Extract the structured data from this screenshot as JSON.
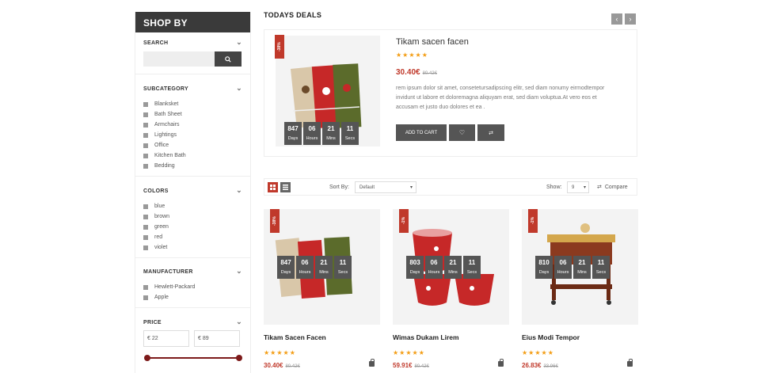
{
  "sidebar": {
    "title": "SHOP BY",
    "search": {
      "title": "SEARCH",
      "placeholder": ""
    },
    "subcategory": {
      "title": "SUBCATEGORY",
      "items": [
        "Blanksket",
        "Bath Sheet",
        "Armchairs",
        "Lightings",
        "Office",
        "Kitchen Bath",
        "Bedding"
      ]
    },
    "colors": {
      "title": "COLORS",
      "items": [
        "blue",
        "brown",
        "green",
        "red",
        "violet"
      ]
    },
    "manufacturer": {
      "title": "MANUFACTURER",
      "items": [
        "Hewlett-Packard",
        "Apple"
      ]
    },
    "price": {
      "title": "PRICE",
      "min": "€ 22",
      "max": "€ 89"
    }
  },
  "deals": {
    "title": "TODAYS DEALS",
    "product": {
      "badge": "-38%",
      "name": "Tikam sacen facen",
      "stars": "★★★★★",
      "price": "30.40€",
      "old_price": "80.42€",
      "description": "rem ipsum dolor sit amet, consetetursadipscing elitr, sed diam nonumy eirmodtempor invidunt ut labore et doloremagna aliquyam erat, sed diam voluptua.At vero eos et accusam et justo duo dolores et ea .",
      "countdown": [
        {
          "value": "847",
          "label": "Days"
        },
        {
          "value": "06",
          "label": "Hours"
        },
        {
          "value": "21",
          "label": "Mins"
        },
        {
          "value": "11",
          "label": "Secs"
        }
      ],
      "add_to_cart": "ADD TO CART"
    }
  },
  "toolbar": {
    "sort_label": "Sort By:",
    "sort_value": "Default",
    "show_label": "Show:",
    "show_value": "9",
    "compare_label": "Compare"
  },
  "products": [
    {
      "badge": "-38%",
      "name": "Tikam Sacen Facen",
      "stars": "★★★★★",
      "price": "30.40€",
      "old_price": "80.42€",
      "countdown": [
        {
          "value": "847",
          "label": "Days"
        },
        {
          "value": "06",
          "label": "Hours"
        },
        {
          "value": "21",
          "label": "Mins"
        },
        {
          "value": "11",
          "label": "Secs"
        }
      ]
    },
    {
      "badge": "-1%",
      "name": "Wimas Dukam Lirem",
      "stars": "★★★★★",
      "price": "59.91€",
      "old_price": "80.42€",
      "countdown": [
        {
          "value": "803",
          "label": "Days"
        },
        {
          "value": "06",
          "label": "Hours"
        },
        {
          "value": "21",
          "label": "Mins"
        },
        {
          "value": "11",
          "label": "Secs"
        }
      ]
    },
    {
      "badge": "-1%",
      "name": "Eius Modi Tempor",
      "stars": "★★★★★",
      "price": "26.83€",
      "old_price": "33.96€",
      "countdown": [
        {
          "value": "810",
          "label": "Days"
        },
        {
          "value": "06",
          "label": "Hours"
        },
        {
          "value": "21",
          "label": "Mins"
        },
        {
          "value": "11",
          "label": "Secs"
        }
      ]
    }
  ],
  "colors": {
    "accent": "#c0392b",
    "dark": "#555555",
    "star": "#f39c12",
    "slider": "#7d1a1a"
  }
}
